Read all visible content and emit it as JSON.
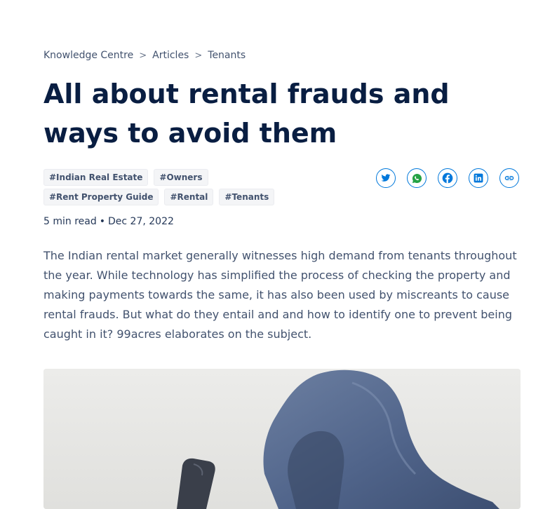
{
  "breadcrumb": {
    "items": [
      "Knowledge Centre",
      "Articles",
      "Tenants"
    ],
    "separator": ">"
  },
  "article": {
    "title": "All about rental frauds and ways to avoid them",
    "tags": [
      "#Indian Real Estate",
      "#Owners",
      "#Rent Property Guide",
      "#Rental",
      "#Tenants"
    ],
    "read_time": "5 min read",
    "date": "Dec 27, 2022",
    "meta_separator": "•",
    "intro": "The Indian rental market generally witnesses high demand from tenants throughout the year. While technology has simplified the process of checking the property and making payments towards the same, it has also been used by miscreants to cause rental frauds. But what do they entail and and how to identify one to prevent being caught in it? 99acres elaborates on the subject."
  },
  "share": {
    "icons": [
      "twitter-icon",
      "whatsapp-icon",
      "facebook-icon",
      "linkedin-icon",
      "link-icon"
    ],
    "accent_color": "#0078db"
  },
  "hero_image": {
    "description": "photo"
  },
  "colors": {
    "title": "#091e42",
    "body_text": "#42526e",
    "tag_background": "#f4f5f7"
  }
}
